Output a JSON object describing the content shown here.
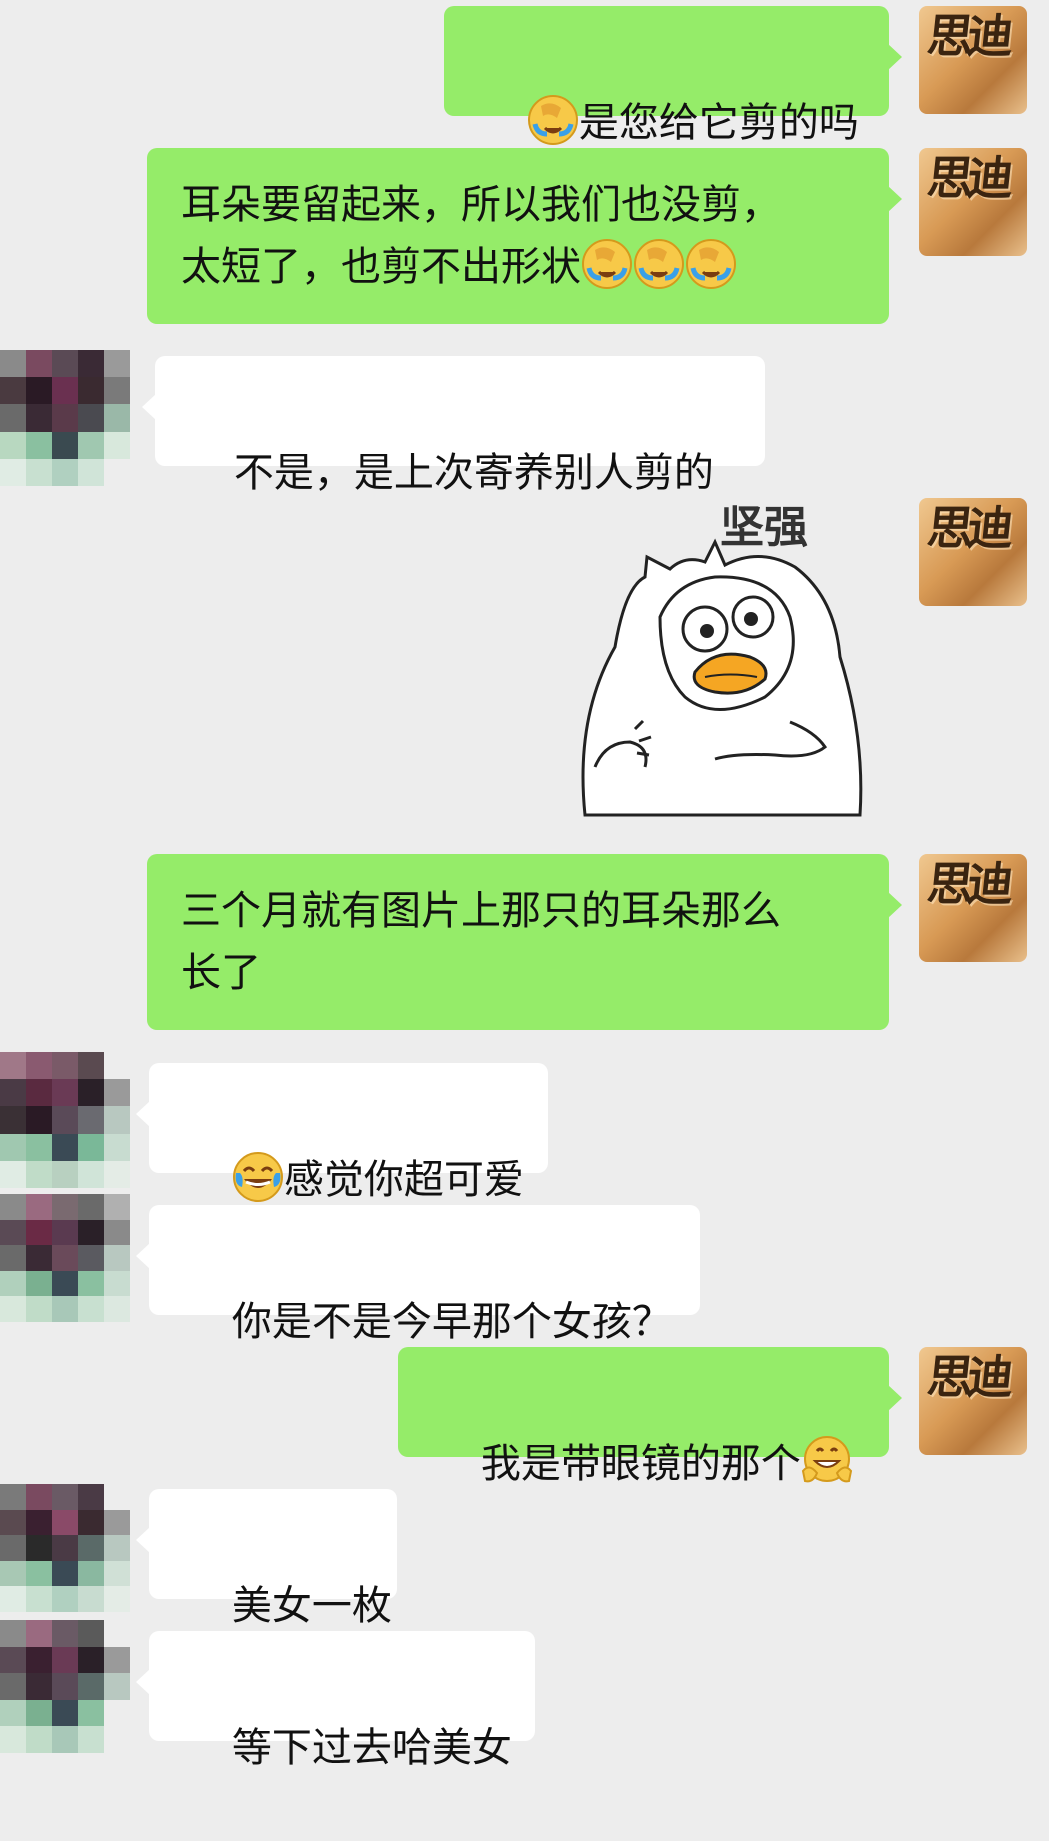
{
  "messages": [
    {
      "side": "me",
      "text": "是您给它剪的吗",
      "prefix_emoji": "facepalm-cry-emoji"
    },
    {
      "side": "me",
      "line1": "耳朵要留起来，所以我们也没剪，",
      "line2": "太短了，也剪不出形状",
      "suffix_emoji": "facepalm-cry-emoji"
    },
    {
      "side": "them",
      "text": "不是，是上次寄养别人剪的"
    },
    {
      "side": "me",
      "sticker_text": "坚强",
      "sticker": "duck-flexing-sticker"
    },
    {
      "side": "me",
      "line1": "三个月就有图片上那只的耳朵那么",
      "line2": "长了"
    },
    {
      "side": "them",
      "text": "感觉你超可爱",
      "prefix_emoji": "tears-of-joy-emoji"
    },
    {
      "side": "them",
      "text": "你是不是今早那个女孩？"
    },
    {
      "side": "me",
      "text": "我是带眼镜的那个",
      "suffix_emoji": "grinning-hands-emoji"
    },
    {
      "side": "them",
      "text": "美女一枚"
    },
    {
      "side": "them",
      "text": "等下过去哈美女"
    }
  ],
  "my_avatar": {
    "logo_text": "思迪"
  },
  "colors": {
    "background": "#ededed",
    "my_bubble": "#95ec69",
    "their_bubble": "#ffffff"
  }
}
